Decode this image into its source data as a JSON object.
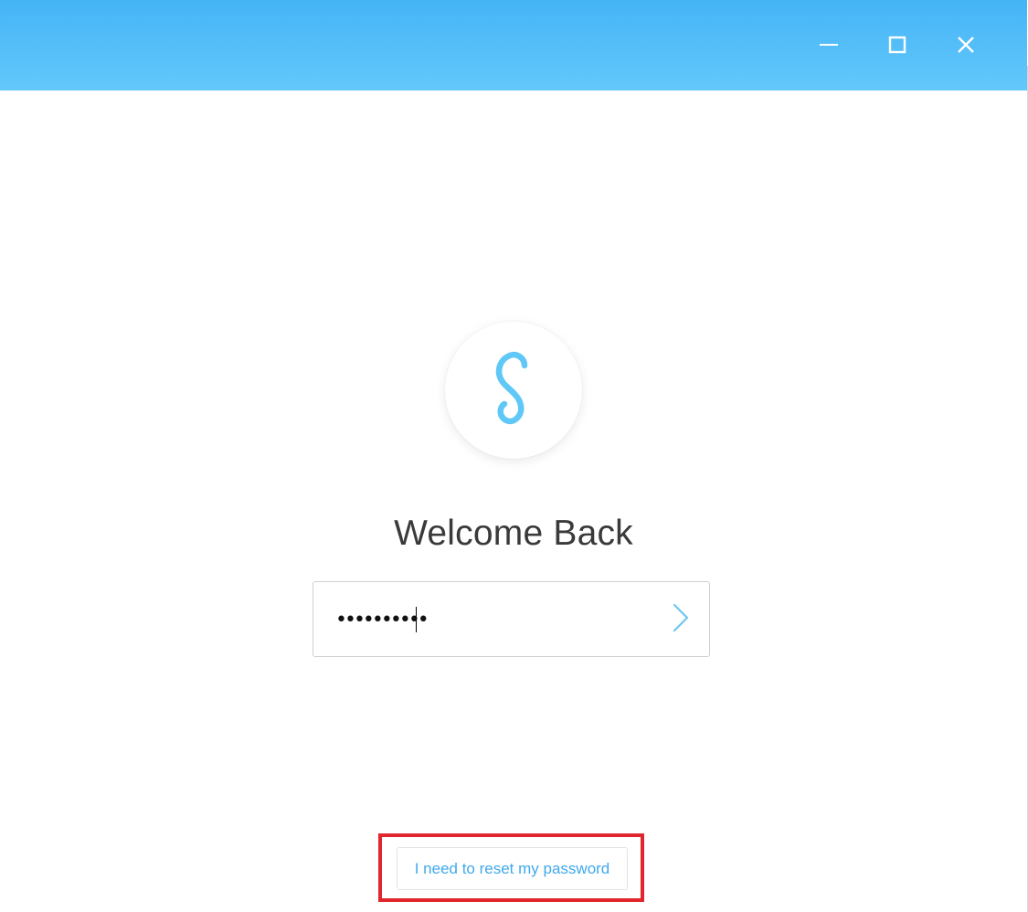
{
  "window": {
    "controls": {
      "minimize_icon": "minimize-icon",
      "maximize_icon": "maximize-icon",
      "close_icon": "close-icon"
    },
    "titlebar_gradient": [
      "#45b4f6",
      "#63c8fb"
    ]
  },
  "logo": {
    "icon": "s-logo-icon",
    "color": "#5fc8f7"
  },
  "login": {
    "heading": "Welcome Back",
    "password_value": "••••••••••",
    "submit_icon": "chevron-right-icon",
    "accent": "#6ec6f0"
  },
  "footer": {
    "reset_label": "I need to reset my password",
    "link_color": "#3fa9ec",
    "highlight_color": "#e0262f"
  }
}
